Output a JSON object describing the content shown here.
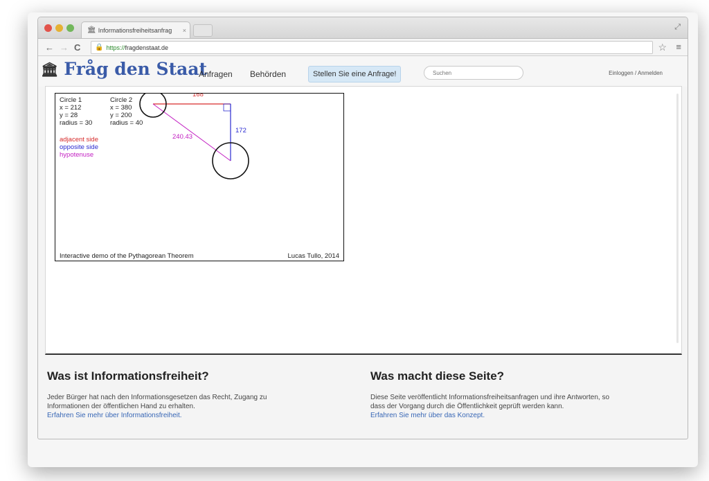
{
  "browser": {
    "tab_title": "Informationsfreiheitsanfrag",
    "tab_close": "×",
    "url_scheme": "https://",
    "url_host": "fragdenstaat.de"
  },
  "site": {
    "logo": "Fråg den Staat",
    "nav": [
      "Anfragen",
      "Behörden"
    ],
    "cta": "Stellen Sie eine Anfrage!",
    "search_placeholder": "Suchen",
    "login": "Einloggen / Anmelden"
  },
  "demo": {
    "circle1": {
      "title": "Circle 1",
      "x": "x = 212",
      "y": "y = 28",
      "r": "radius = 30"
    },
    "circle2": {
      "title": "Circle 2",
      "x": "x = 380",
      "y": "y = 200",
      "r": "radius = 40"
    },
    "legend": [
      "adjacent side",
      "opposite side",
      "hypotenuse"
    ],
    "labels": {
      "adjacent": "168",
      "opposite": "172",
      "hypotenuse": "240.43"
    },
    "footer_left": "Interactive demo of the Pythagorean Theorem",
    "footer_right": "Lucas Tullo, 2014",
    "colors": {
      "adjacent": "#d62b2b",
      "opposite": "#2a2ad0",
      "hypotenuse": "#c21fc2"
    }
  },
  "info": {
    "col1": {
      "heading": "Was ist Informationsfreiheit?",
      "line1": "Jeder Bürger hat nach den Informationsgesetzen das Recht, Zugang zu",
      "line2": "Informationen der öffentlichen Hand zu erhalten.",
      "link": "Erfahren Sie mehr über Informationsfreiheit."
    },
    "col2": {
      "heading": "Was macht diese Seite?",
      "line1": "Diese Seite veröffentlicht Informationsfreiheitsanfragen und ihre Antworten, so",
      "line2": "dass der Vorgang durch die Öffentlichkeit geprüft werden kann.",
      "link": "Erfahren Sie mehr über das Konzept."
    }
  }
}
